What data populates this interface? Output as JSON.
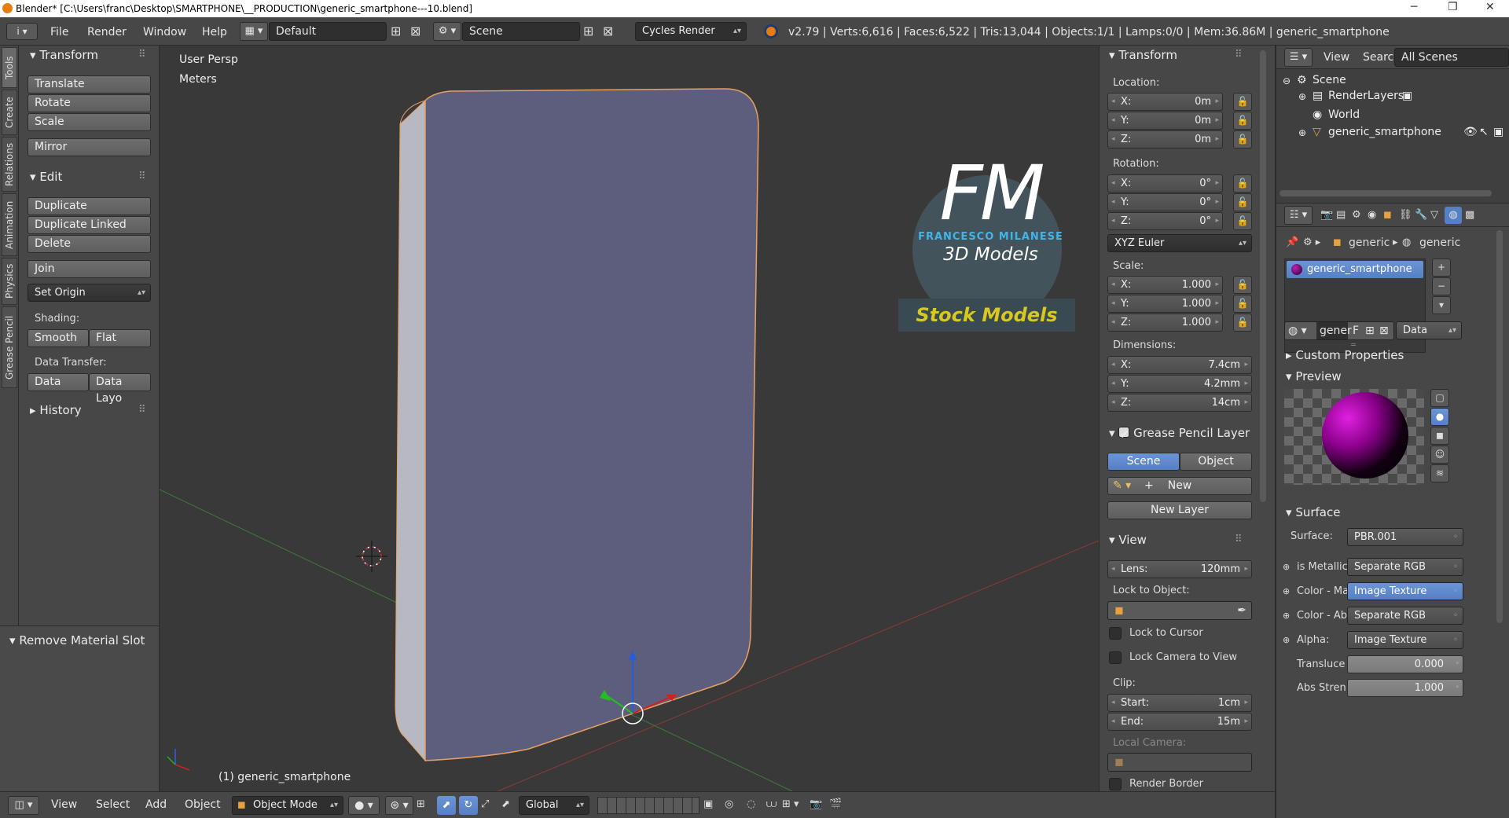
{
  "titlebar": {
    "title": "Blender* [C:\\Users\\franc\\Desktop\\SMARTPHONE\\__PRODUCTION\\generic_smartphone---10.blend]",
    "min": "─",
    "max": "❐",
    "close": "✕"
  },
  "menu": {
    "info_icon": "i",
    "file": "File",
    "render": "Render",
    "window": "Window",
    "help": "Help",
    "layout": "Default",
    "scene": "Scene",
    "engine": "Cycles Render",
    "stats": "v2.79 | Verts:6,616 | Faces:6,522 | Tris:13,044 | Objects:1/1 | Lamps:0/0 | Mem:36.86M | generic_smartphone"
  },
  "lefttabs": [
    "Tools",
    "Create",
    "Relations",
    "Animation",
    "Physics",
    "Grease Pencil"
  ],
  "toolshelf": {
    "transform": "Transform",
    "translate": "Translate",
    "rotate": "Rotate",
    "scale": "Scale",
    "mirror": "Mirror",
    "edit": "Edit",
    "duplicate": "Duplicate",
    "duplicate_linked": "Duplicate Linked",
    "delete": "Delete",
    "join": "Join",
    "set_origin": "Set Origin",
    "shading": "Shading:",
    "smooth": "Smooth",
    "flat": "Flat",
    "data_transfer": "Data Transfer:",
    "data": "Data",
    "data_layo": "Data Layo",
    "history": "History"
  },
  "operator": {
    "title": "Remove Material Slot"
  },
  "viewport": {
    "persp": "User Persp",
    "units": "Meters",
    "object_label": "(1) generic_smartphone",
    "logo_fm": "FM",
    "logo_author": "FRANCESCO MILANESE",
    "logo_sub": "3D Models",
    "logo_stock": "Stock Models"
  },
  "npanel": {
    "transform": "Transform",
    "location": "Location:",
    "loc": [
      {
        "k": "X:",
        "v": "0m"
      },
      {
        "k": "Y:",
        "v": "0m"
      },
      {
        "k": "Z:",
        "v": "0m"
      }
    ],
    "rotation": "Rotation:",
    "rot": [
      {
        "k": "X:",
        "v": "0°"
      },
      {
        "k": "Y:",
        "v": "0°"
      },
      {
        "k": "Z:",
        "v": "0°"
      }
    ],
    "euler": "XYZ Euler",
    "scale": "Scale:",
    "scl": [
      {
        "k": "X:",
        "v": "1.000"
      },
      {
        "k": "Y:",
        "v": "1.000"
      },
      {
        "k": "Z:",
        "v": "1.000"
      }
    ],
    "dimensions": "Dimensions:",
    "dim": [
      {
        "k": "X:",
        "v": "7.4cm"
      },
      {
        "k": "Y:",
        "v": "4.2mm"
      },
      {
        "k": "Z:",
        "v": "14cm"
      }
    ],
    "gp_layer": "Grease Pencil Layer",
    "gp_scene": "Scene",
    "gp_object": "Object",
    "gp_new": "New",
    "gp_new_layer": "New Layer",
    "view": "View",
    "lens_k": "Lens:",
    "lens_v": "120mm",
    "lock_obj": "Lock to Object:",
    "lock_cursor": "Lock to Cursor",
    "lock_camera": "Lock Camera to View",
    "clip": "Clip:",
    "clip_start_k": "Start:",
    "clip_start_v": "1cm",
    "clip_end_k": "End:",
    "clip_end_v": "15m",
    "local_camera": "Local Camera:",
    "render_border": "Render Border"
  },
  "outliner": {
    "view": "View",
    "search": "Search",
    "filter": "All Scenes",
    "scene": "Scene",
    "renderlayers": "RenderLayers",
    "world": "World",
    "object": "generic_smartphone"
  },
  "props": {
    "crumb1": "generic",
    "crumb2": "generic",
    "material_slot": "generic_smartphone",
    "mat_name": "gener",
    "mat_f": "F",
    "data": "Data",
    "custom_props": "Custom Properties",
    "preview": "Preview",
    "surface": "Surface",
    "surface_k": "Surface:",
    "surface_v": "PBR.001",
    "rows": [
      {
        "k": "is Metallic",
        "v": "Separate RGB"
      },
      {
        "k": "Color - Ma",
        "v": "Image Texture"
      },
      {
        "k": "Color - Ab",
        "v": "Separate RGB"
      },
      {
        "k": "Alpha:",
        "v": "Image Texture"
      }
    ],
    "transluce_k": "Transluce",
    "transluce_v": "0.000",
    "abs_k": "Abs Stren",
    "abs_v": "1.000"
  },
  "bottombar": {
    "view": "View",
    "select": "Select",
    "add": "Add",
    "object": "Object",
    "mode": "Object Mode",
    "orientation": "Global"
  }
}
